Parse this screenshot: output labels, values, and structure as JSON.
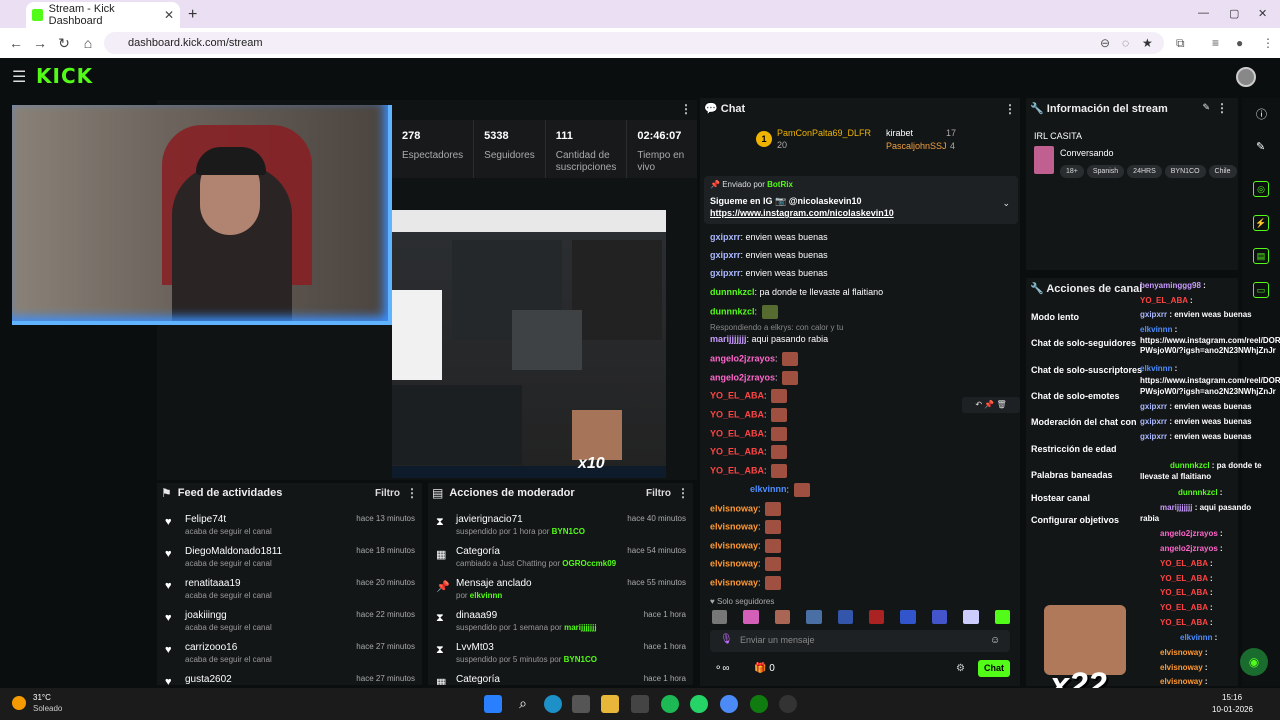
{
  "browser": {
    "tab_title": "Stream - Kick Dashboard",
    "url": "dashboard.kick.com/stream"
  },
  "brand": {
    "logo": "KICK",
    "accent": "#53fc18"
  },
  "stats": [
    {
      "value": "278",
      "label": "Espectadores"
    },
    {
      "value": "5338",
      "label": "Seguidores"
    },
    {
      "value": "111",
      "label": "Cantidad de suscripciones"
    },
    {
      "value": "02:46:07",
      "label": "Tiempo en vivo"
    }
  ],
  "preview": {
    "overlay_text": "x10"
  },
  "feed": {
    "title": "Feed de actividades",
    "filter": "Filtro",
    "items": [
      {
        "name": "Felipe74t",
        "sub": "acaba de seguir el canal",
        "time": "hace 13 minutos"
      },
      {
        "name": "DiegoMaldonado1811",
        "sub": "acaba de seguir el canal",
        "time": "hace 18 minutos"
      },
      {
        "name": "renatitaaa19",
        "sub": "acaba de seguir el canal",
        "time": "hace 20 minutos"
      },
      {
        "name": "joakiiingg",
        "sub": "acaba de seguir el canal",
        "time": "hace 22 minutos"
      },
      {
        "name": "carrizooo16",
        "sub": "acaba de seguir el canal",
        "time": "hace 27 minutos"
      },
      {
        "name": "gusta2602",
        "sub": "",
        "time": "hace 27 minutos"
      }
    ]
  },
  "mod": {
    "title": "Acciones de moderador",
    "filter": "Filtro",
    "items": [
      {
        "name": "javierignacio71",
        "sub": "suspendido por 1 hora por",
        "by": "BYN1CO",
        "time": "hace 40 minutos"
      },
      {
        "name": "Categoría",
        "sub": "cambiado a Just Chatting por",
        "by": "OGROccmk09",
        "time": "hace 54 minutos"
      },
      {
        "name": "Mensaje anclado",
        "sub": "por",
        "by": "elkvinnn",
        "time": "hace 55 minutos"
      },
      {
        "name": "dinaaa99",
        "sub": "suspendido por 1 semana por",
        "by": "marijjjjjjj",
        "time": "hace 1 hora"
      },
      {
        "name": "LvvMt03",
        "sub": "suspendido por 5 minutos por",
        "by": "BYN1CO",
        "time": "hace 1 hora"
      },
      {
        "name": "Categoría",
        "sub": "",
        "by": "",
        "time": "hace 1 hora"
      }
    ]
  },
  "chat": {
    "title": "Chat",
    "top": [
      {
        "name": "PamConPalta69_DLFR",
        "count": "20"
      },
      {
        "name": "kirabet",
        "count": "17"
      },
      {
        "name": "PascaljohnSSJ",
        "count": "4"
      }
    ],
    "pinned": {
      "by_label": "Enviado por",
      "by": "BotRix",
      "text": "Sigueme en IG 📷 @nicolaskevin10",
      "link": "https://www.instagram.com/nicolaskevin10"
    },
    "messages": [
      {
        "user": "gxipxrr",
        "text": "envien weas buenas",
        "color": "#aab8ff"
      },
      {
        "user": "gxipxrr",
        "text": "envien weas buenas",
        "color": "#aab8ff"
      },
      {
        "user": "gxipxrr",
        "text": "envien weas buenas",
        "color": "#aab8ff"
      },
      {
        "user": "dunnnkzcl",
        "text": "pa donde te llevaste al flaitiano",
        "color": "#53fc18"
      },
      {
        "user": "dunnnkzcl",
        "text": "",
        "color": "#53fc18"
      },
      {
        "user": "marijjjjjjj",
        "text": "aqui pasando rabia",
        "color": "#c99cff"
      },
      {
        "user": "angelo2jzrayos",
        "text": "",
        "color": "#ff66cc"
      },
      {
        "user": "angelo2jzrayos",
        "text": "",
        "color": "#ff66cc"
      },
      {
        "user": "YO_EL_ABA",
        "text": "",
        "color": "#ff4444"
      },
      {
        "user": "YO_EL_ABA",
        "text": "",
        "color": "#ff4444"
      },
      {
        "user": "YO_EL_ABA",
        "text": "",
        "color": "#ff4444"
      },
      {
        "user": "YO_EL_ABA",
        "text": "",
        "color": "#ff4444"
      },
      {
        "user": "YO_EL_ABA",
        "text": "",
        "color": "#ff4444"
      },
      {
        "user": "elkvinnn",
        "text": "",
        "color": "#4d8dff"
      },
      {
        "user": "elvisnoway",
        "text": "",
        "color": "#ff9933"
      },
      {
        "user": "elvisnoway",
        "text": "",
        "color": "#ff9933"
      },
      {
        "user": "elvisnoway",
        "text": "",
        "color": "#ff9933"
      },
      {
        "user": "elvisnoway",
        "text": "",
        "color": "#ff9933"
      },
      {
        "user": "elvisnoway",
        "text": "",
        "color": "#ff9933"
      }
    ],
    "reply_hint": "Respondiendo a elkrys: con calor y tu",
    "followers_only": "Solo seguidores",
    "input_placeholder": "Enviar un mensaje",
    "send": "Chat",
    "points": "0"
  },
  "info": {
    "title": "Información del stream",
    "stream_title": "IRL CASITA",
    "category": "Conversando",
    "tags": [
      "18+",
      "Spanish",
      "24HRS",
      "BYN1CO",
      "Chile"
    ]
  },
  "actions": {
    "title": "Acciones de canal",
    "items": [
      "Modo lento",
      "Chat de solo-seguidores",
      "Chat de solo-suscriptores",
      "Chat de solo-emotes",
      "Moderación del chat con IA",
      "Restricción de edad",
      "Palabras baneadas",
      "Hostear canal",
      "Configurar objetivos"
    ]
  },
  "overlay_chat": [
    {
      "user": "benyaminggg98",
      "text": "",
      "color": "#c99cff"
    },
    {
      "user": "YO_EL_ABA",
      "text": "",
      "color": "#ff4444"
    },
    {
      "user": "gxipxrr",
      "text": "envien weas buenas",
      "color": "#aab8ff"
    },
    {
      "user": "elkvinnn",
      "text": "",
      "color": "#4d8dff"
    },
    {
      "user": "",
      "text": "https://www.instagram.com/reel/DORC",
      "color": "#fff"
    },
    {
      "user": "",
      "text": "PWsjoW0/?igsh=ano2N23NWhjZnJr",
      "color": "#fff"
    },
    {
      "user": "elkvinnn",
      "text": "",
      "color": "#4d8dff"
    },
    {
      "user": "",
      "text": "https://www.instagram.com/reel/DORC",
      "color": "#fff"
    },
    {
      "user": "",
      "text": "PWsjoW0/?igsh=ano2N23NWhjZnJr",
      "color": "#fff"
    },
    {
      "user": "gxipxrr",
      "text": "envien weas buenas",
      "color": "#aab8ff"
    },
    {
      "user": "gxipxrr",
      "text": "envien weas buenas",
      "color": "#aab8ff"
    },
    {
      "user": "gxipxrr",
      "text": "envien weas buenas",
      "color": "#aab8ff"
    },
    {
      "user": "dunnnkzcl",
      "text": "pa donde te",
      "color": "#53fc18"
    },
    {
      "user": "",
      "text": "llevaste al flaitiano",
      "color": "#fff"
    },
    {
      "user": "dunnnkzcl",
      "text": "",
      "color": "#53fc18"
    },
    {
      "user": "marijjjjjjj",
      "text": "aqui pasando",
      "color": "#c99cff"
    },
    {
      "user": "",
      "text": "rabia",
      "color": "#fff"
    },
    {
      "user": "angelo2jzrayos",
      "text": "",
      "color": "#ff66cc"
    },
    {
      "user": "angelo2jzrayos",
      "text": "",
      "color": "#ff66cc"
    },
    {
      "user": "YO_EL_ABA",
      "text": "",
      "color": "#ff4444"
    },
    {
      "user": "YO_EL_ABA",
      "text": "",
      "color": "#ff4444"
    },
    {
      "user": "YO_EL_ABA",
      "text": "",
      "color": "#ff4444"
    },
    {
      "user": "YO_EL_ABA",
      "text": "",
      "color": "#ff4444"
    },
    {
      "user": "YO_EL_ABA",
      "text": "",
      "color": "#ff4444"
    },
    {
      "user": "elkvinnn",
      "text": "",
      "color": "#4d8dff"
    },
    {
      "user": "elvisnoway",
      "text": "",
      "color": "#ff9933"
    },
    {
      "user": "elvisnoway",
      "text": "",
      "color": "#ff9933"
    },
    {
      "user": "elvisnoway",
      "text": "",
      "color": "#ff9933"
    },
    {
      "user": "elvisnoway",
      "text": "",
      "color": "#ff9933"
    }
  ],
  "overlay_badge": "x22",
  "taskbar": {
    "temp": "31°C",
    "weather": "Soleado",
    "time": "15:16",
    "date": "10-01-2026"
  }
}
